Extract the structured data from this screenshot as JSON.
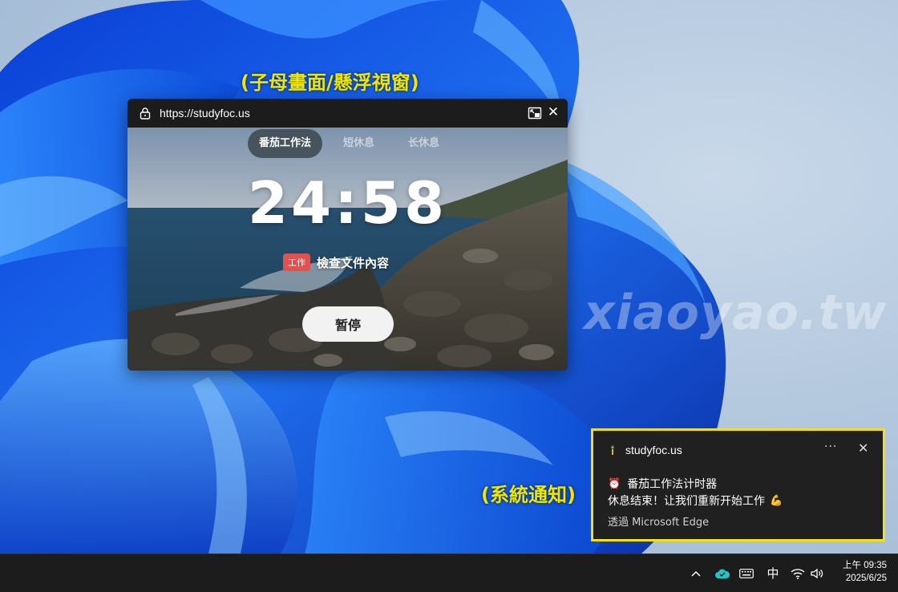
{
  "annotations": {
    "pip_label": "(子母畫面/懸浮視窗)",
    "notification_label": "(系統通知)"
  },
  "watermark": "xiaoyao.tw",
  "pip_window": {
    "url": "https://studyfoc.us",
    "tabs": [
      {
        "label": "番茄工作法",
        "active": true
      },
      {
        "label": "短休息",
        "active": false
      },
      {
        "label": "长休息",
        "active": false
      }
    ],
    "timer": "24:58",
    "task_tag": "工作",
    "task_text": "檢查文件內容",
    "pause_label": "暂停"
  },
  "notification": {
    "app_name": "studyfoc.us",
    "more_label": "···",
    "close_label": "✕",
    "title": "番茄工作法计时器",
    "body": "休息结束！让我们重新开始工作",
    "via": "透過 Microsoft Edge",
    "icons": {
      "title": "alarm-clock-icon",
      "body": "flexed-biceps-icon"
    }
  },
  "taskbar": {
    "ime": "中",
    "time": "上午 09:35",
    "date": "2025/6/25"
  },
  "colors": {
    "annotation": "#f2e600",
    "notification_border": "#f0e020",
    "task_tag": "#e0524f"
  }
}
